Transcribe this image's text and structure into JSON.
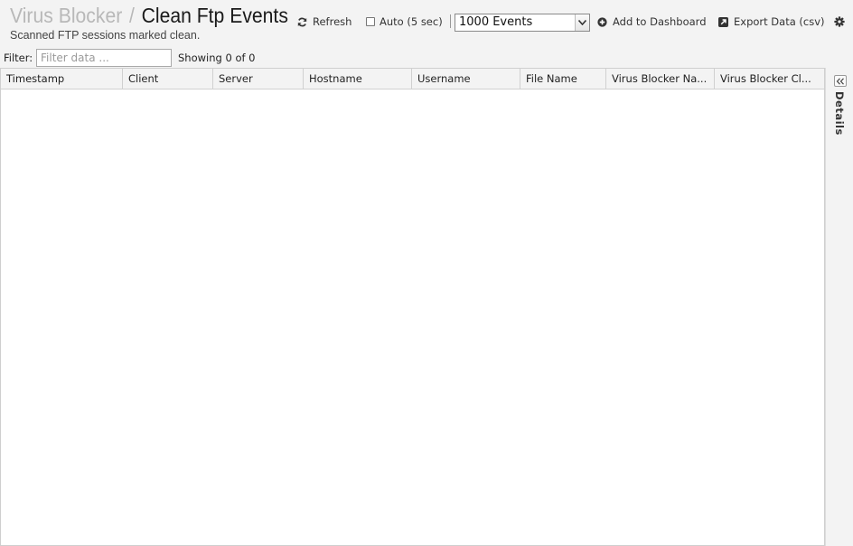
{
  "header": {
    "breadcrumb_parent": "Virus Blocker",
    "separator": "/",
    "title": "Clean Ftp Events",
    "subtitle": "Scanned FTP sessions marked clean."
  },
  "toolbar": {
    "refresh_label": "Refresh",
    "refresh_icon": "refresh-icon",
    "auto_label": "Auto (5 sec)",
    "auto_checked": false,
    "events_select_value": "1000 Events",
    "add_dashboard_label": "Add to Dashboard",
    "add_dashboard_icon": "plus-circle-icon",
    "export_label": "Export Data (csv)",
    "export_icon": "external-link-icon",
    "settings_icon": "gear-icon"
  },
  "filter": {
    "label": "Filter:",
    "placeholder": "Filter data ...",
    "value": "",
    "showing": "Showing 0 of 0"
  },
  "grid": {
    "columns": [
      "Timestamp",
      "Client",
      "Server",
      "Hostname",
      "Username",
      "File Name",
      "Virus Blocker Na...",
      "Virus Blocker Cl..."
    ],
    "rows": []
  },
  "details_panel": {
    "label": "Details",
    "collapse_icon": "double-chevron-left-icon"
  }
}
